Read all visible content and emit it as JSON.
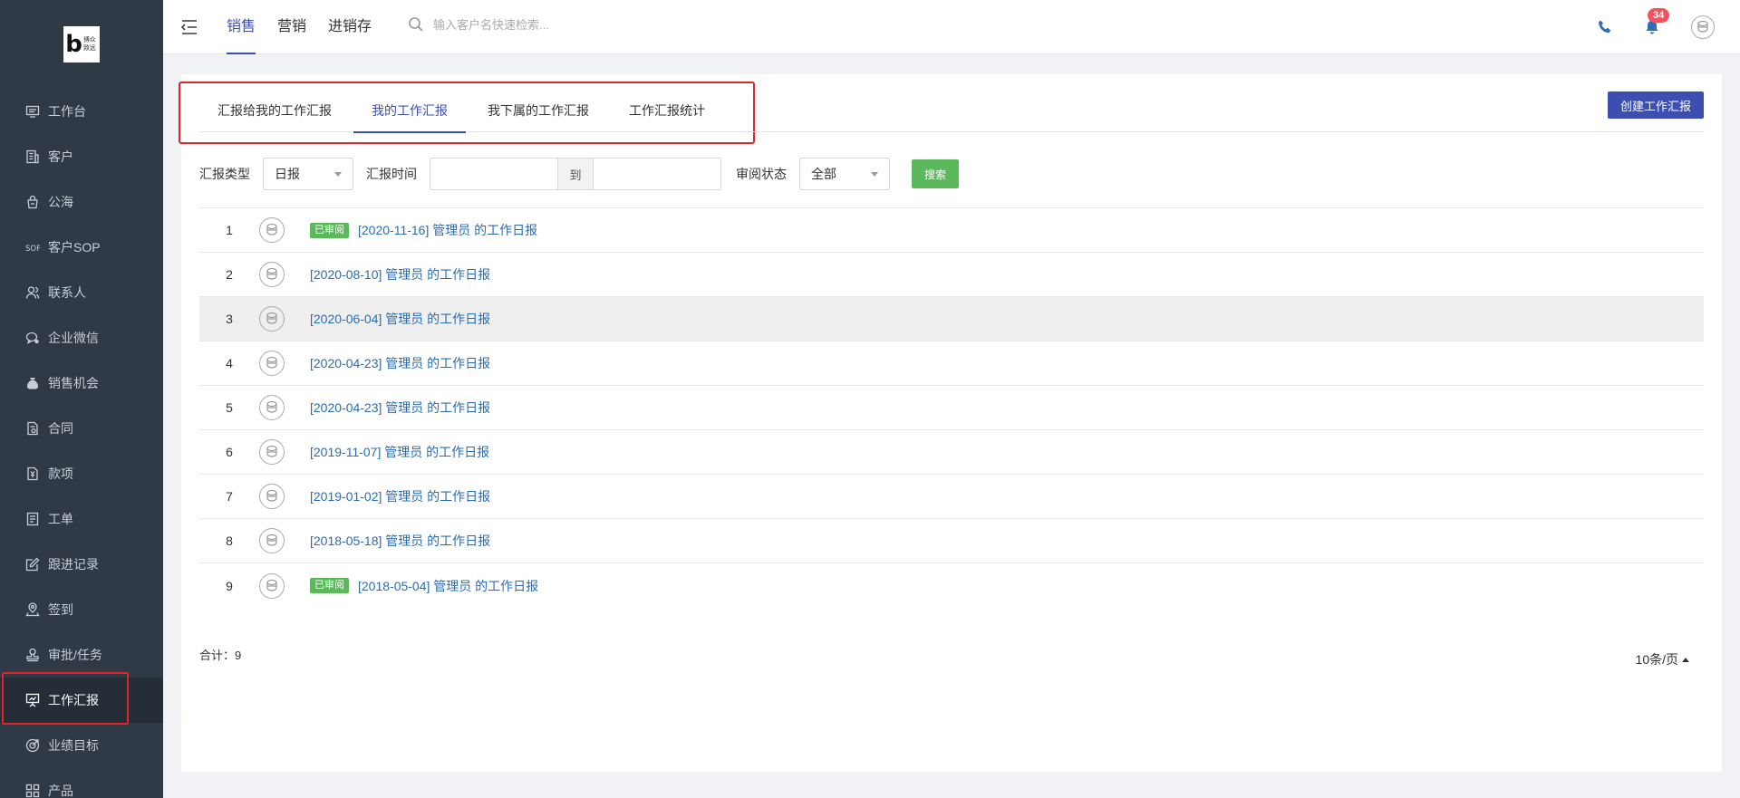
{
  "logo": {
    "glyph": "b",
    "text": "博众致远"
  },
  "sidebar": {
    "items": [
      {
        "label": "工作台",
        "icon": "monitor-icon"
      },
      {
        "label": "客户",
        "icon": "building-icon"
      },
      {
        "label": "公海",
        "icon": "bag-icon"
      },
      {
        "label": "客户SOP",
        "icon": "sop-icon"
      },
      {
        "label": "联系人",
        "icon": "contacts-icon"
      },
      {
        "label": "企业微信",
        "icon": "wechat-icon"
      },
      {
        "label": "销售机会",
        "icon": "moneybag-icon"
      },
      {
        "label": "合同",
        "icon": "contract-icon"
      },
      {
        "label": "款项",
        "icon": "payment-icon"
      },
      {
        "label": "工单",
        "icon": "ticket-icon"
      },
      {
        "label": "跟进记录",
        "icon": "edit-icon"
      },
      {
        "label": "签到",
        "icon": "location-icon"
      },
      {
        "label": "审批/任务",
        "icon": "approval-icon"
      },
      {
        "label": "工作汇报",
        "icon": "presentation-icon",
        "active": true
      },
      {
        "label": "业绩目标",
        "icon": "target-icon"
      },
      {
        "label": "产品",
        "icon": "grid-icon"
      }
    ]
  },
  "topbar": {
    "tabs": [
      "销售",
      "营销",
      "进销存"
    ],
    "active_tab": 0,
    "search_placeholder": "输入客户名快速检索...",
    "notification_count": "34"
  },
  "subtabs": {
    "items": [
      "汇报给我的工作汇报",
      "我的工作汇报",
      "我下属的工作汇报",
      "工作汇报统计"
    ],
    "active": 1
  },
  "create_label": "创建工作汇报",
  "filters": {
    "type_label": "汇报类型",
    "type_value": "日报",
    "time_label": "汇报时间",
    "to_label": "到",
    "start_value": "",
    "end_value": "",
    "status_label": "审阅状态",
    "status_value": "全部",
    "search_label": "搜索"
  },
  "reports": [
    {
      "num": "1",
      "reviewed": true,
      "title": "[2020-11-16] 管理员 的工作日报"
    },
    {
      "num": "2",
      "reviewed": false,
      "title": "[2020-08-10] 管理员 的工作日报"
    },
    {
      "num": "3",
      "reviewed": false,
      "title": "[2020-06-04] 管理员 的工作日报"
    },
    {
      "num": "4",
      "reviewed": false,
      "title": "[2020-04-23] 管理员 的工作日报"
    },
    {
      "num": "5",
      "reviewed": false,
      "title": "[2020-04-23] 管理员 的工作日报"
    },
    {
      "num": "6",
      "reviewed": false,
      "title": "[2019-11-07] 管理员 的工作日报"
    },
    {
      "num": "7",
      "reviewed": false,
      "title": "[2019-01-02] 管理员 的工作日报"
    },
    {
      "num": "8",
      "reviewed": false,
      "title": "[2018-05-18] 管理员 的工作日报"
    },
    {
      "num": "9",
      "reviewed": true,
      "title": "[2018-05-04] 管理员 的工作日报"
    }
  ],
  "reviewed_label": "已审阅",
  "footer": {
    "total": "合计：9",
    "page_size": "10条/页"
  },
  "colors": {
    "accent": "#3c4fb1",
    "success": "#5cb85c",
    "link": "#2b6cb0",
    "highlight": "#e0262c",
    "sidebar": "#2f3a46"
  }
}
